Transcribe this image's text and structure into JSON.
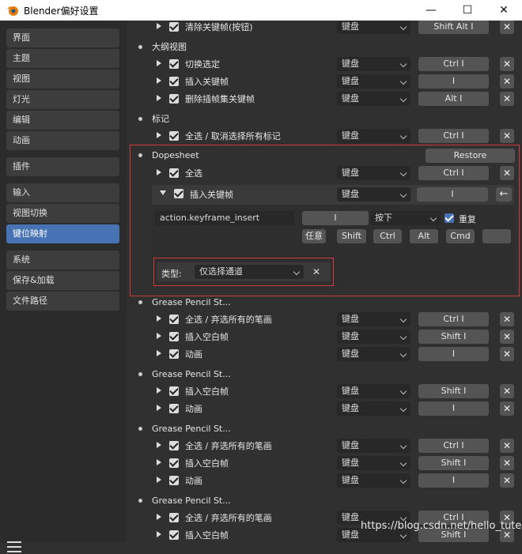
{
  "window": {
    "title": "Blender偏好设置",
    "minimize": "—",
    "maximize": "☐",
    "close": "✕"
  },
  "sidebar": {
    "group1": [
      "界面",
      "主题",
      "视图",
      "灯光",
      "编辑",
      "动画"
    ],
    "group2": [
      "插件"
    ],
    "group3": [
      "输入",
      "视图切换",
      "键位映射"
    ],
    "group4": [
      "系统",
      "保存&加载",
      "文件路径"
    ],
    "active": "键位映射"
  },
  "common": {
    "input_type": "键盘",
    "remove": "✕"
  },
  "rows": {
    "r0": {
      "name": "清除关键帧(按钮)",
      "key": "Shift Alt I"
    },
    "s1": "大纲视图",
    "r1": {
      "name": "切换选定",
      "key": "Ctrl I"
    },
    "r2": {
      "name": "插入关键帧",
      "key": "I"
    },
    "r3": {
      "name": "删除插帧集关键帧",
      "key": "Alt I"
    },
    "s2": "标记",
    "r4": {
      "name": "全选 / 取消选择所有标记",
      "key": "Ctrl I"
    },
    "s3": "Dopesheet",
    "restore": "Restore",
    "r5": {
      "name": "全选",
      "key": "Ctrl I"
    },
    "expanded": {
      "name": "插入关键帧",
      "key": "I",
      "back_icon": "←",
      "operator": "action.keyframe_insert",
      "key2": "I",
      "event": "按下",
      "repeat": "重复",
      "modifiers": [
        "任意",
        "Shift",
        "Ctrl",
        "Alt",
        "Cmd",
        ""
      ],
      "type_label": "类型:",
      "type_value": "仅选择通道"
    },
    "s4": "Grease Pencil St...",
    "r6": {
      "name": "全选 / 弃选所有的笔画",
      "key": "Ctrl I"
    },
    "r7": {
      "name": "插入空白帧",
      "key": "Shift I"
    },
    "r8": {
      "name": "动画",
      "key": "I"
    },
    "s5": "Grease Pencil St...",
    "r9": {
      "name": "插入空白帧",
      "key": "Shift I"
    },
    "r10": {
      "name": "动画",
      "key": "I"
    },
    "s6": "Grease Pencil St...",
    "r11": {
      "name": "全选 / 弃选所有的笔画",
      "key": "Ctrl I"
    },
    "r12": {
      "name": "插入空白帧",
      "key": "Shift I"
    },
    "r13": {
      "name": "动画",
      "key": "I"
    },
    "s7": "Grease Pencil St...",
    "r14": {
      "name": "全选 / 弃选所有的笔画",
      "key": "Ctrl I"
    },
    "r15": {
      "name": "插入空白帧",
      "key": "Shift I"
    }
  },
  "watermark": "https://blog.csdn.net/hello_tute"
}
